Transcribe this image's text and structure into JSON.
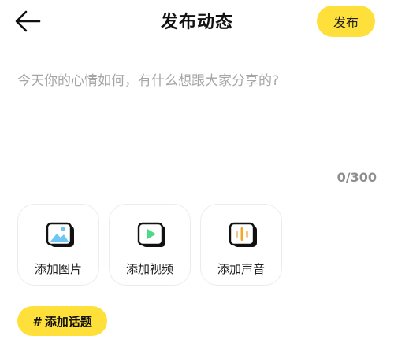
{
  "header": {
    "title": "发布动态",
    "publish_label": "发布",
    "back_icon": "back-arrow-icon"
  },
  "composer": {
    "placeholder": "今天你的心情如何，有什么想跟大家分享的?",
    "value": "",
    "char_count": "0/300"
  },
  "media_options": [
    {
      "label": "添加图片",
      "icon": "image-icon",
      "accent": "#6EC6F5"
    },
    {
      "label": "添加视频",
      "icon": "video-play-icon",
      "accent": "#4CD98A"
    },
    {
      "label": "添加声音",
      "icon": "audio-wave-icon",
      "accent": "#F5A623"
    }
  ],
  "topic": {
    "hash": "#",
    "label": "添加话题"
  },
  "colors": {
    "accent_yellow": "#FFE03A",
    "placeholder_gray": "#A6A6A6",
    "card_border": "#ECECEC"
  }
}
